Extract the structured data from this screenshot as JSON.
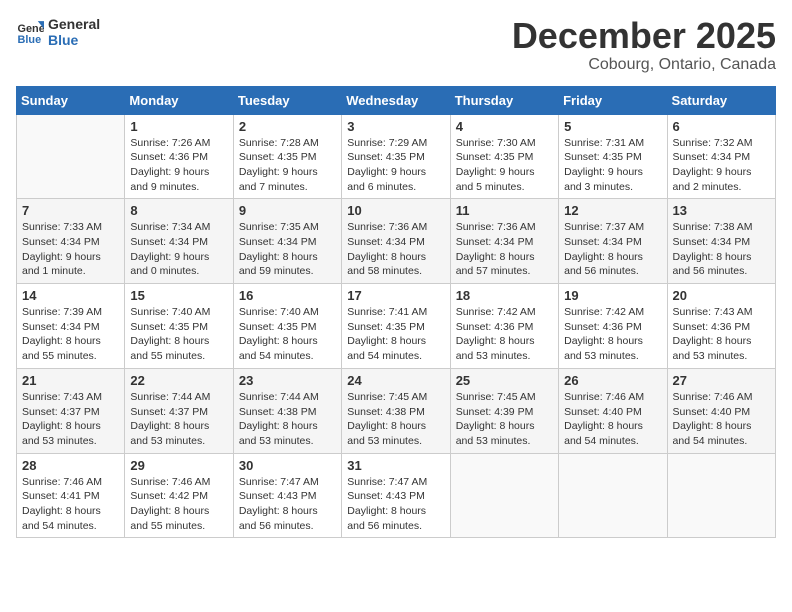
{
  "logo": {
    "line1": "General",
    "line2": "Blue"
  },
  "calendar": {
    "title": "December 2025",
    "subtitle": "Cobourg, Ontario, Canada"
  },
  "weekdays": [
    "Sunday",
    "Monday",
    "Tuesday",
    "Wednesday",
    "Thursday",
    "Friday",
    "Saturday"
  ],
  "weeks": [
    [
      {
        "day": "",
        "info": ""
      },
      {
        "day": "1",
        "info": "Sunrise: 7:26 AM\nSunset: 4:36 PM\nDaylight: 9 hours\nand 9 minutes."
      },
      {
        "day": "2",
        "info": "Sunrise: 7:28 AM\nSunset: 4:35 PM\nDaylight: 9 hours\nand 7 minutes."
      },
      {
        "day": "3",
        "info": "Sunrise: 7:29 AM\nSunset: 4:35 PM\nDaylight: 9 hours\nand 6 minutes."
      },
      {
        "day": "4",
        "info": "Sunrise: 7:30 AM\nSunset: 4:35 PM\nDaylight: 9 hours\nand 5 minutes."
      },
      {
        "day": "5",
        "info": "Sunrise: 7:31 AM\nSunset: 4:35 PM\nDaylight: 9 hours\nand 3 minutes."
      },
      {
        "day": "6",
        "info": "Sunrise: 7:32 AM\nSunset: 4:34 PM\nDaylight: 9 hours\nand 2 minutes."
      }
    ],
    [
      {
        "day": "7",
        "info": "Sunrise: 7:33 AM\nSunset: 4:34 PM\nDaylight: 9 hours\nand 1 minute."
      },
      {
        "day": "8",
        "info": "Sunrise: 7:34 AM\nSunset: 4:34 PM\nDaylight: 9 hours\nand 0 minutes."
      },
      {
        "day": "9",
        "info": "Sunrise: 7:35 AM\nSunset: 4:34 PM\nDaylight: 8 hours\nand 59 minutes."
      },
      {
        "day": "10",
        "info": "Sunrise: 7:36 AM\nSunset: 4:34 PM\nDaylight: 8 hours\nand 58 minutes."
      },
      {
        "day": "11",
        "info": "Sunrise: 7:36 AM\nSunset: 4:34 PM\nDaylight: 8 hours\nand 57 minutes."
      },
      {
        "day": "12",
        "info": "Sunrise: 7:37 AM\nSunset: 4:34 PM\nDaylight: 8 hours\nand 56 minutes."
      },
      {
        "day": "13",
        "info": "Sunrise: 7:38 AM\nSunset: 4:34 PM\nDaylight: 8 hours\nand 56 minutes."
      }
    ],
    [
      {
        "day": "14",
        "info": "Sunrise: 7:39 AM\nSunset: 4:34 PM\nDaylight: 8 hours\nand 55 minutes."
      },
      {
        "day": "15",
        "info": "Sunrise: 7:40 AM\nSunset: 4:35 PM\nDaylight: 8 hours\nand 55 minutes."
      },
      {
        "day": "16",
        "info": "Sunrise: 7:40 AM\nSunset: 4:35 PM\nDaylight: 8 hours\nand 54 minutes."
      },
      {
        "day": "17",
        "info": "Sunrise: 7:41 AM\nSunset: 4:35 PM\nDaylight: 8 hours\nand 54 minutes."
      },
      {
        "day": "18",
        "info": "Sunrise: 7:42 AM\nSunset: 4:36 PM\nDaylight: 8 hours\nand 53 minutes."
      },
      {
        "day": "19",
        "info": "Sunrise: 7:42 AM\nSunset: 4:36 PM\nDaylight: 8 hours\nand 53 minutes."
      },
      {
        "day": "20",
        "info": "Sunrise: 7:43 AM\nSunset: 4:36 PM\nDaylight: 8 hours\nand 53 minutes."
      }
    ],
    [
      {
        "day": "21",
        "info": "Sunrise: 7:43 AM\nSunset: 4:37 PM\nDaylight: 8 hours\nand 53 minutes."
      },
      {
        "day": "22",
        "info": "Sunrise: 7:44 AM\nSunset: 4:37 PM\nDaylight: 8 hours\nand 53 minutes."
      },
      {
        "day": "23",
        "info": "Sunrise: 7:44 AM\nSunset: 4:38 PM\nDaylight: 8 hours\nand 53 minutes."
      },
      {
        "day": "24",
        "info": "Sunrise: 7:45 AM\nSunset: 4:38 PM\nDaylight: 8 hours\nand 53 minutes."
      },
      {
        "day": "25",
        "info": "Sunrise: 7:45 AM\nSunset: 4:39 PM\nDaylight: 8 hours\nand 53 minutes."
      },
      {
        "day": "26",
        "info": "Sunrise: 7:46 AM\nSunset: 4:40 PM\nDaylight: 8 hours\nand 54 minutes."
      },
      {
        "day": "27",
        "info": "Sunrise: 7:46 AM\nSunset: 4:40 PM\nDaylight: 8 hours\nand 54 minutes."
      }
    ],
    [
      {
        "day": "28",
        "info": "Sunrise: 7:46 AM\nSunset: 4:41 PM\nDaylight: 8 hours\nand 54 minutes."
      },
      {
        "day": "29",
        "info": "Sunrise: 7:46 AM\nSunset: 4:42 PM\nDaylight: 8 hours\nand 55 minutes."
      },
      {
        "day": "30",
        "info": "Sunrise: 7:47 AM\nSunset: 4:43 PM\nDaylight: 8 hours\nand 56 minutes."
      },
      {
        "day": "31",
        "info": "Sunrise: 7:47 AM\nSunset: 4:43 PM\nDaylight: 8 hours\nand 56 minutes."
      },
      {
        "day": "",
        "info": ""
      },
      {
        "day": "",
        "info": ""
      },
      {
        "day": "",
        "info": ""
      }
    ]
  ]
}
